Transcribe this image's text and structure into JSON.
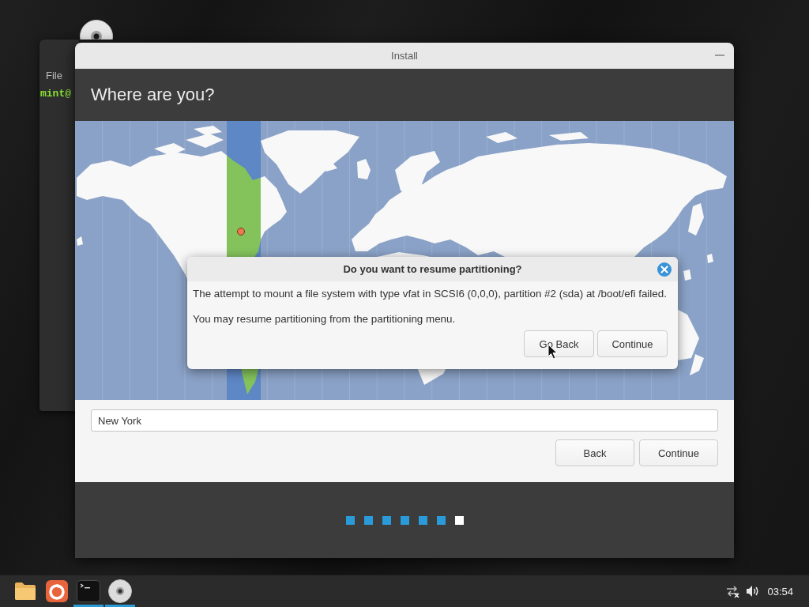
{
  "desktop": {
    "icons": [
      {
        "kind": "disc"
      }
    ]
  },
  "background_window": {
    "menu": [
      "File"
    ],
    "prompt": "mint@"
  },
  "window": {
    "title": "Install",
    "heading": "Where are you?",
    "location": {
      "value": "New York"
    },
    "buttons": [
      {
        "label": "Back"
      },
      {
        "label": "Continue"
      }
    ],
    "steps": [
      {
        "selected": false
      },
      {
        "selected": false
      },
      {
        "selected": false
      },
      {
        "selected": false
      },
      {
        "selected": false
      },
      {
        "selected": false
      },
      {
        "selected": true
      }
    ]
  },
  "dialog": {
    "title": "Do you want to resume partitioning?",
    "messages": [
      "The attempt to mount a file system with type vfat in SCSI6 (0,0,0), partition #2 (sda) at /boot/efi failed.",
      "You may resume partitioning from the partitioning menu."
    ],
    "buttons": [
      {
        "label": "Go Back"
      },
      {
        "label": "Continue"
      }
    ]
  },
  "taskbar": {
    "launchers": [
      {
        "kind": "folder",
        "running": false
      },
      {
        "kind": "browser",
        "running": false
      },
      {
        "kind": "terminal",
        "running": true
      },
      {
        "kind": "disc",
        "running": true
      }
    ],
    "clock": "03:54"
  }
}
